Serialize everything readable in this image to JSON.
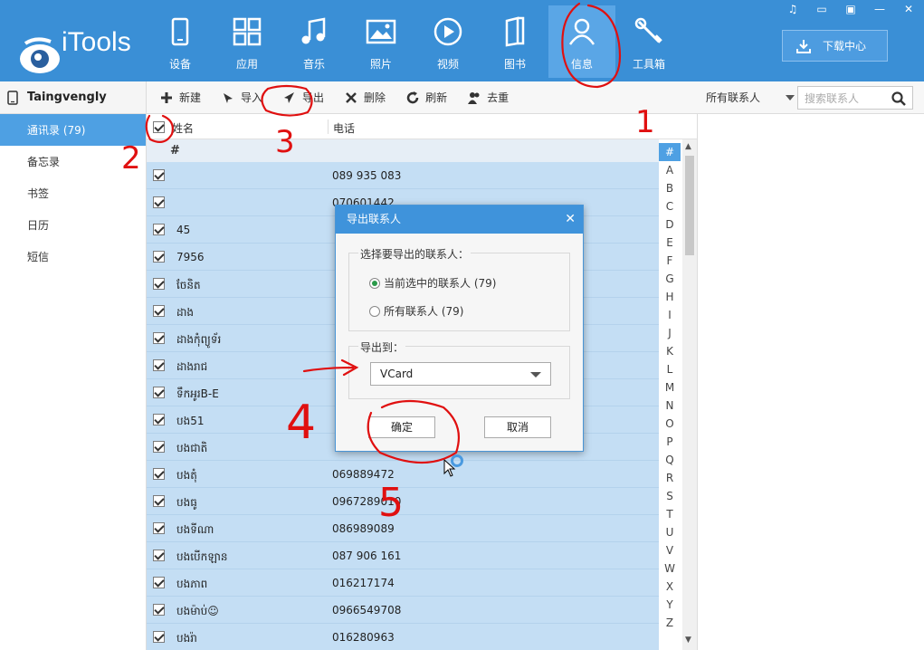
{
  "app": {
    "logo_text": "iTools",
    "download_label": "下载中心"
  },
  "nav": [
    {
      "label": "设备",
      "icon": "device-icon"
    },
    {
      "label": "应用",
      "icon": "apps-icon"
    },
    {
      "label": "音乐",
      "icon": "music-icon"
    },
    {
      "label": "照片",
      "icon": "photo-icon"
    },
    {
      "label": "视频",
      "icon": "video-icon"
    },
    {
      "label": "图书",
      "icon": "book-icon"
    },
    {
      "label": "信息",
      "icon": "contact-icon"
    },
    {
      "label": "工具箱",
      "icon": "toolbox-icon"
    }
  ],
  "sidebar": {
    "device_name": "Taingvengly",
    "items": [
      {
        "label": "通讯录 (79)"
      },
      {
        "label": "备忘录"
      },
      {
        "label": "书签"
      },
      {
        "label": "日历"
      },
      {
        "label": "短信"
      }
    ]
  },
  "toolbar": {
    "new_label": "新建",
    "import_label": "导入",
    "export_label": "导出",
    "delete_label": "删除",
    "refresh_label": "刷新",
    "dedupe_label": "去重",
    "filter_label": "所有联系人",
    "search_placeholder": "搜索联系人"
  },
  "table": {
    "col_name": "姓名",
    "col_phone": "电话",
    "group_label": "#",
    "rows": [
      {
        "name": "",
        "phone": "089 935 083"
      },
      {
        "name": "",
        "phone": "070601442"
      },
      {
        "name": "45",
        "phone": ""
      },
      {
        "name": "7956",
        "phone": ""
      },
      {
        "name": "ចែនិត",
        "phone": ""
      },
      {
        "name": "ដាង",
        "phone": ""
      },
      {
        "name": "ដាងកុំព្យូទ័រ",
        "phone": ""
      },
      {
        "name": "ដាងរាជ",
        "phone": ""
      },
      {
        "name": "ទឹកអូរB-E",
        "phone": ""
      },
      {
        "name": "បង51",
        "phone": ""
      },
      {
        "name": "បងជាតិ",
        "phone": ""
      },
      {
        "name": "បងតុំ",
        "phone": "069889472"
      },
      {
        "name": "បងធូ",
        "phone": "0967289010"
      },
      {
        "name": "បងទីណា",
        "phone": "086989089"
      },
      {
        "name": "បងបើកឡាន",
        "phone": "087 906 161"
      },
      {
        "name": "បងភាព",
        "phone": "016217174"
      },
      {
        "name": "បងម៉ាប់☺",
        "phone": "0966549708"
      },
      {
        "name": "បងរ៉ា",
        "phone": "016280963"
      }
    ]
  },
  "alphabet": [
    "#",
    "A",
    "B",
    "C",
    "D",
    "E",
    "F",
    "G",
    "H",
    "I",
    "J",
    "K",
    "L",
    "M",
    "N",
    "O",
    "P",
    "Q",
    "R",
    "S",
    "T",
    "U",
    "V",
    "W",
    "X",
    "Y",
    "Z"
  ],
  "dialog": {
    "title": "导出联系人",
    "close_glyph": "✕",
    "select_group_label": "选择要导出的联系人：",
    "option_selected": "当前选中的联系人 (79)",
    "option_all": "所有联系人 (79)",
    "export_to_label": "导出到：",
    "format_value": "VCard",
    "ok_label": "确定",
    "cancel_label": "取消"
  },
  "annotations": {
    "n1": "1",
    "n2": "2",
    "n3": "3",
    "n4": "4",
    "n5": "5"
  },
  "colors": {
    "header_blue": "#3a8fd6",
    "selected_row": "#c4def4",
    "annotation_red": "#e01010"
  }
}
